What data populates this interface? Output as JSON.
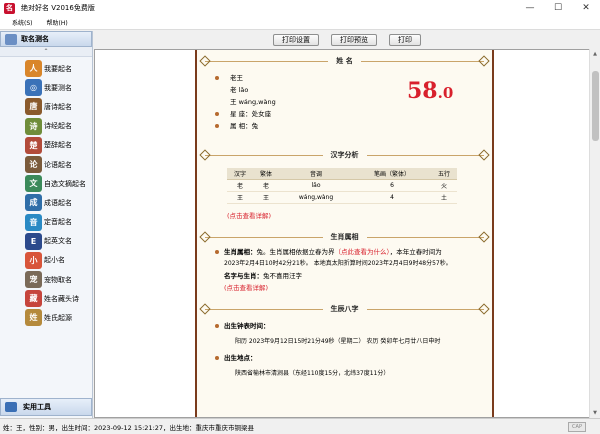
{
  "window": {
    "title": "绝对好名 V2016免费版",
    "icon_glyph": "名",
    "controls": {
      "minimize": "—",
      "maximize": "☐",
      "close": "✕"
    }
  },
  "menu": [
    "系统(S)",
    "帮助(H)"
  ],
  "sidebar": {
    "header": "取名测名",
    "scroll_up": "⌃",
    "items": [
      {
        "label": "我要起名",
        "icon": "person-icon",
        "color": "#d9862a",
        "glyph": "人"
      },
      {
        "label": "我要测名",
        "icon": "magnifier-icon",
        "color": "#3a72b8",
        "glyph": "◎"
      },
      {
        "label": "唐诗起名",
        "icon": "tang-poem-icon",
        "color": "#8a5a2c",
        "glyph": "唐"
      },
      {
        "label": "诗经起名",
        "icon": "book-icon",
        "color": "#6f8d3a",
        "glyph": "诗"
      },
      {
        "label": "楚辞起名",
        "icon": "scroll-icon",
        "color": "#b24b3a",
        "glyph": "楚"
      },
      {
        "label": "论语起名",
        "icon": "sage-icon",
        "color": "#7b5b3b",
        "glyph": "论"
      },
      {
        "label": "自选文摘起名",
        "icon": "books-icon",
        "color": "#3b8a5a",
        "glyph": "文"
      },
      {
        "label": "成语起名",
        "icon": "idiom-book-icon",
        "color": "#2f6ea8",
        "glyph": "成"
      },
      {
        "label": "定音起名",
        "icon": "globe-icon",
        "color": "#2a8ac4",
        "glyph": "音"
      },
      {
        "label": "起英文名",
        "icon": "uk-flag-icon",
        "color": "#2c4a8c",
        "glyph": "E"
      },
      {
        "label": "起小名",
        "icon": "baby-icon",
        "color": "#d8553a",
        "glyph": "小"
      },
      {
        "label": "宠物取名",
        "icon": "pet-icon",
        "color": "#7a6a58",
        "glyph": "宠"
      },
      {
        "label": "姓名藏头诗",
        "icon": "calligraphy-icon",
        "color": "#c6453c",
        "glyph": "藏"
      },
      {
        "label": "姓氏起源",
        "icon": "scroll-origin-icon",
        "color": "#b58a3c",
        "glyph": "姓"
      }
    ],
    "footer": "实用工具"
  },
  "toolbar": {
    "print_settings": "打印设置",
    "print_preview": "打印预览",
    "print": "打印"
  },
  "report": {
    "name_section": {
      "heading": "姓 名",
      "name": "老王",
      "pinyin_lines": [
        "老 lǎo",
        "王 wáng,wàng"
      ],
      "zodiac_sign_label": "星 座：",
      "zodiac_sign": "处女座",
      "animal_label": "属 相：",
      "animal": "兔",
      "score_main": "58",
      "score_decimal": ".0"
    },
    "hanzi_section": {
      "heading": "汉字分析",
      "columns": [
        "汉字",
        "繁体",
        "音调",
        "笔画（繁体）",
        "五行"
      ],
      "rows": [
        [
          "老",
          "老",
          "lǎo",
          "6",
          "火"
        ],
        [
          "王",
          "王",
          "wáng,wàng",
          "4",
          "土"
        ]
      ],
      "detail_link": "(点击查看详解)"
    },
    "zodiac_section": {
      "heading": "生肖属相",
      "line1_label": "生肖属相：",
      "line1_value": "兔。生肖属相依据立春为界",
      "line1_link": "（点此查看为什么）",
      "line1_tail": "，本年立春时间为",
      "line2": "2023年2月4日10时42分21秒。 本地真太阳折算时间2023年2月4日9时48分57秒。",
      "line3_label": "名字与生肖：",
      "line3_value": "兔不喜用汪字",
      "detail_link": "(点击查看详解)"
    },
    "bazi_section": {
      "heading": "生辰八字",
      "birth_time_label": "出生钟表时间：",
      "birth_time_value": "阳历 2023年9月12日15时21分49秒（星期二） 农历 癸卯年七月廿八日申时",
      "birth_place_label": "出生地点：",
      "birth_place_value": "陕西省榆林市清涧县（东经110度15分，北纬37度11分）"
    }
  },
  "statusbar": {
    "text": "姓：王，性别：男，出生时间：2023-09-12 15:21:27，出生地：重庆市重庆市铜梁县",
    "cap": "CAP"
  }
}
